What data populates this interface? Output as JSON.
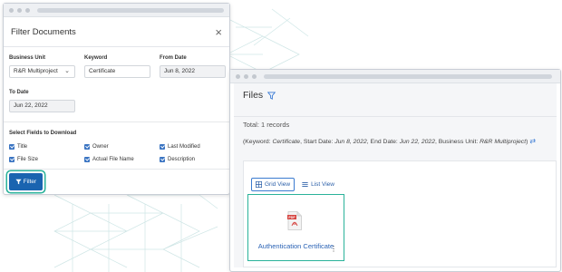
{
  "filter_dialog": {
    "title": "Filter Documents",
    "fields": {
      "business_unit": {
        "label": "Business Unit",
        "value": "R&R Multiproject"
      },
      "keyword": {
        "label": "Keyword",
        "value": "Certificate"
      },
      "from_date": {
        "label": "From Date",
        "value": "Jun 8, 2022"
      },
      "to_date": {
        "label": "To Date",
        "value": "Jun 22, 2022"
      }
    },
    "download_fields_label": "Select Fields to Download",
    "download_fields": [
      {
        "label": "Title",
        "checked": true
      },
      {
        "label": "Owner",
        "checked": true
      },
      {
        "label": "Last Modified",
        "checked": true
      },
      {
        "label": "File Size",
        "checked": true
      },
      {
        "label": "Actual File Name",
        "checked": true
      },
      {
        "label": "Description",
        "checked": true
      }
    ],
    "filter_button": "Filter"
  },
  "files": {
    "title": "Files",
    "total": "Total: 1 records",
    "criteria": {
      "open": "(Keyword: ",
      "keyword": "Certificate",
      "start_label": ", Start Date: ",
      "start": "Jun 8, 2022",
      "end_label": ", End Date: ",
      "end": "Jun 22, 2022",
      "unit_label": ", Business Unit: ",
      "unit": "R&R Multiproject",
      "close": ")"
    },
    "views": {
      "grid": "Grid View",
      "list": "List View",
      "active": "grid"
    },
    "items": [
      {
        "name": "Authentication Certificate",
        "type": "PDF"
      }
    ]
  },
  "colors": {
    "primary": "#1a64b0",
    "accent_teal": "#2ab29a",
    "link": "#2b63b5",
    "pdf_red": "#d64541"
  }
}
